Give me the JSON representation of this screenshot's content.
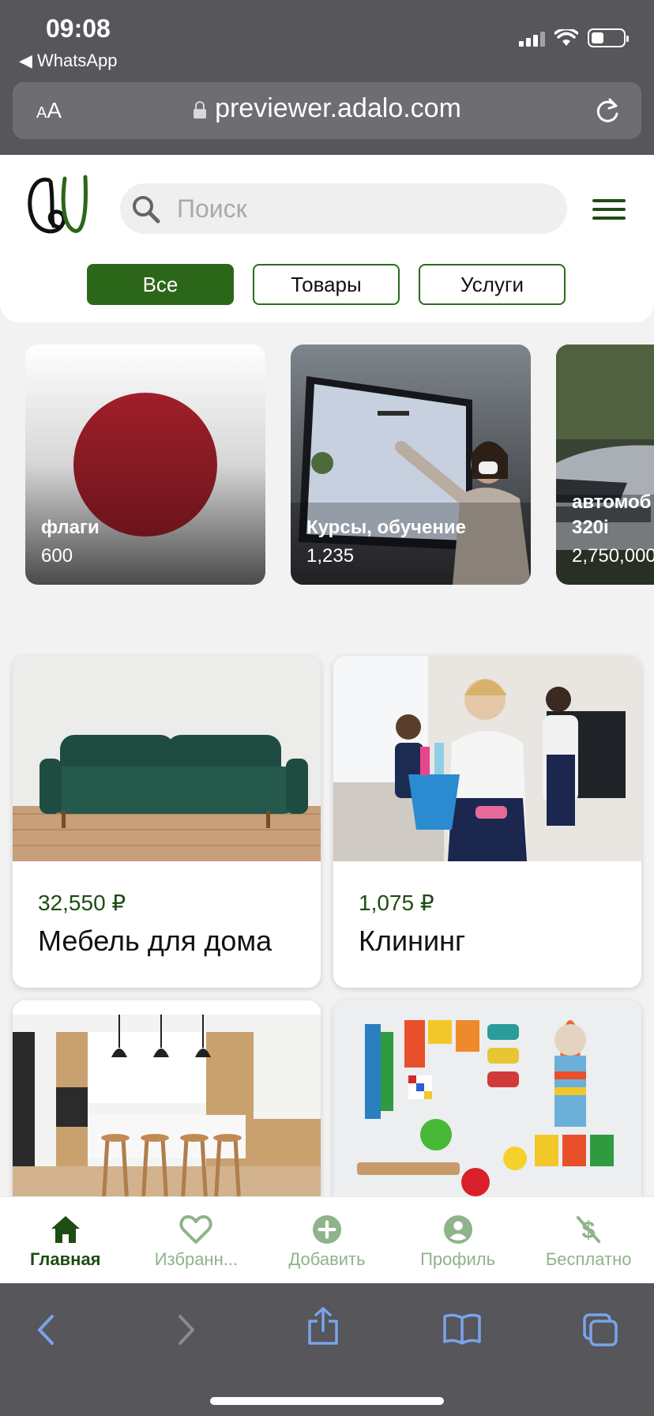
{
  "status_bar": {
    "time": "09:08",
    "back_app": "WhatsApp"
  },
  "browser": {
    "aa_label": "AA",
    "url": "previewer.adalo.com"
  },
  "header": {
    "search_placeholder": "Поиск",
    "tabs": [
      {
        "label": "Все",
        "active": true
      },
      {
        "label": "Товары",
        "active": false
      },
      {
        "label": "Услуги",
        "active": false
      }
    ]
  },
  "categories": [
    {
      "title": "флаги",
      "count": "600"
    },
    {
      "title": "Курсы, обучение",
      "count": "1,235"
    },
    {
      "title": "автомоб",
      "title2": "320i",
      "count": "2,750,000"
    }
  ],
  "products": [
    {
      "price": "32,550 ₽",
      "name": "Мебель для дома"
    },
    {
      "price": "1,075 ₽",
      "name": "Клининг"
    }
  ],
  "bottom_nav": [
    {
      "label": "Главная",
      "icon": "home-icon",
      "active": true
    },
    {
      "label": "Избранн...",
      "icon": "heart-icon",
      "active": false
    },
    {
      "label": "Добавить",
      "icon": "plus-circle-icon",
      "active": false
    },
    {
      "label": "Профиль",
      "icon": "profile-icon",
      "active": false
    },
    {
      "label": "Бесплатно",
      "icon": "no-dollar-icon",
      "active": false
    }
  ],
  "colors": {
    "brand": "#2c6619",
    "nav_inactive": "#8fb38a",
    "chrome": "#56565b"
  }
}
